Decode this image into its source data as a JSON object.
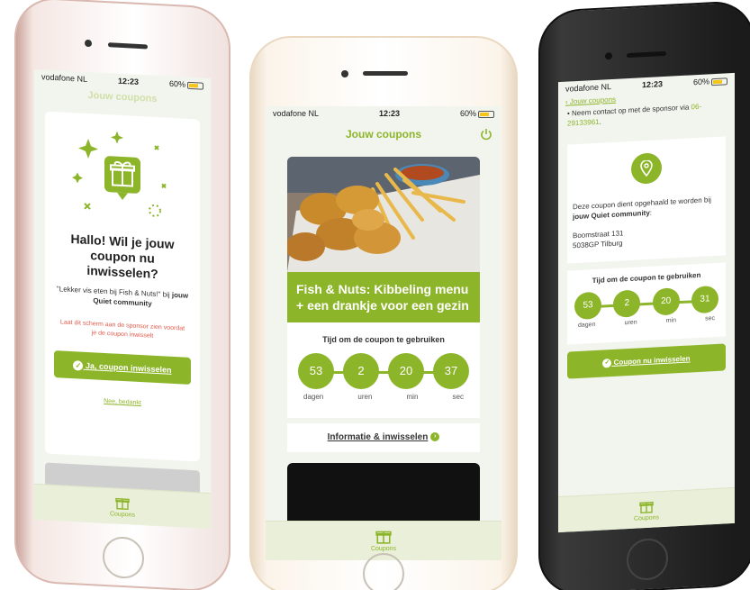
{
  "status": {
    "carrier": "vodafone NL",
    "time": "12:23",
    "battery": "60%"
  },
  "nav": {
    "title": "Jouw coupons"
  },
  "tab": {
    "label": "Coupons"
  },
  "coupon": {
    "title": "Fish & Nuts: Kibbeling menu + een drankje voor een gezin",
    "timer_label": "Tijd om de coupon te gebruiken",
    "values": [
      "53",
      "2",
      "20",
      "37"
    ],
    "units": [
      "dagen",
      "uren",
      "min",
      "sec"
    ],
    "info_link": "Informatie & inwisselen"
  },
  "modal": {
    "heading": "Hallo! Wil je jouw coupon nu inwisselen?",
    "message_pre": "\"Lekker vis eten bij Fish & Nuts!\" bij ",
    "message_bold": "jouw Quiet community",
    "warning": "Laat dit scherm aan de sponsor zien voordat je de coupon inwisselt",
    "confirm": "Ja, coupon inwisselen",
    "decline": "Nee, bedankt"
  },
  "detail": {
    "back": "Jouw coupons",
    "contact_pre": "Neem contact op met de sponsor via ",
    "contact_phone": "06-29133961",
    "pickup_pre": "Deze coupon dient opgehaald te worden bij ",
    "pickup_bold": "jouw Quiet community",
    "address_line1": "Boomstraat 131",
    "address_line2": "5038GP Tilburg",
    "timer_values": [
      "53",
      "2",
      "20",
      "31"
    ],
    "redeem": "Coupon nu inwisselen"
  },
  "colors": {
    "accent": "#8db52a",
    "warning": "#e05a4a"
  }
}
